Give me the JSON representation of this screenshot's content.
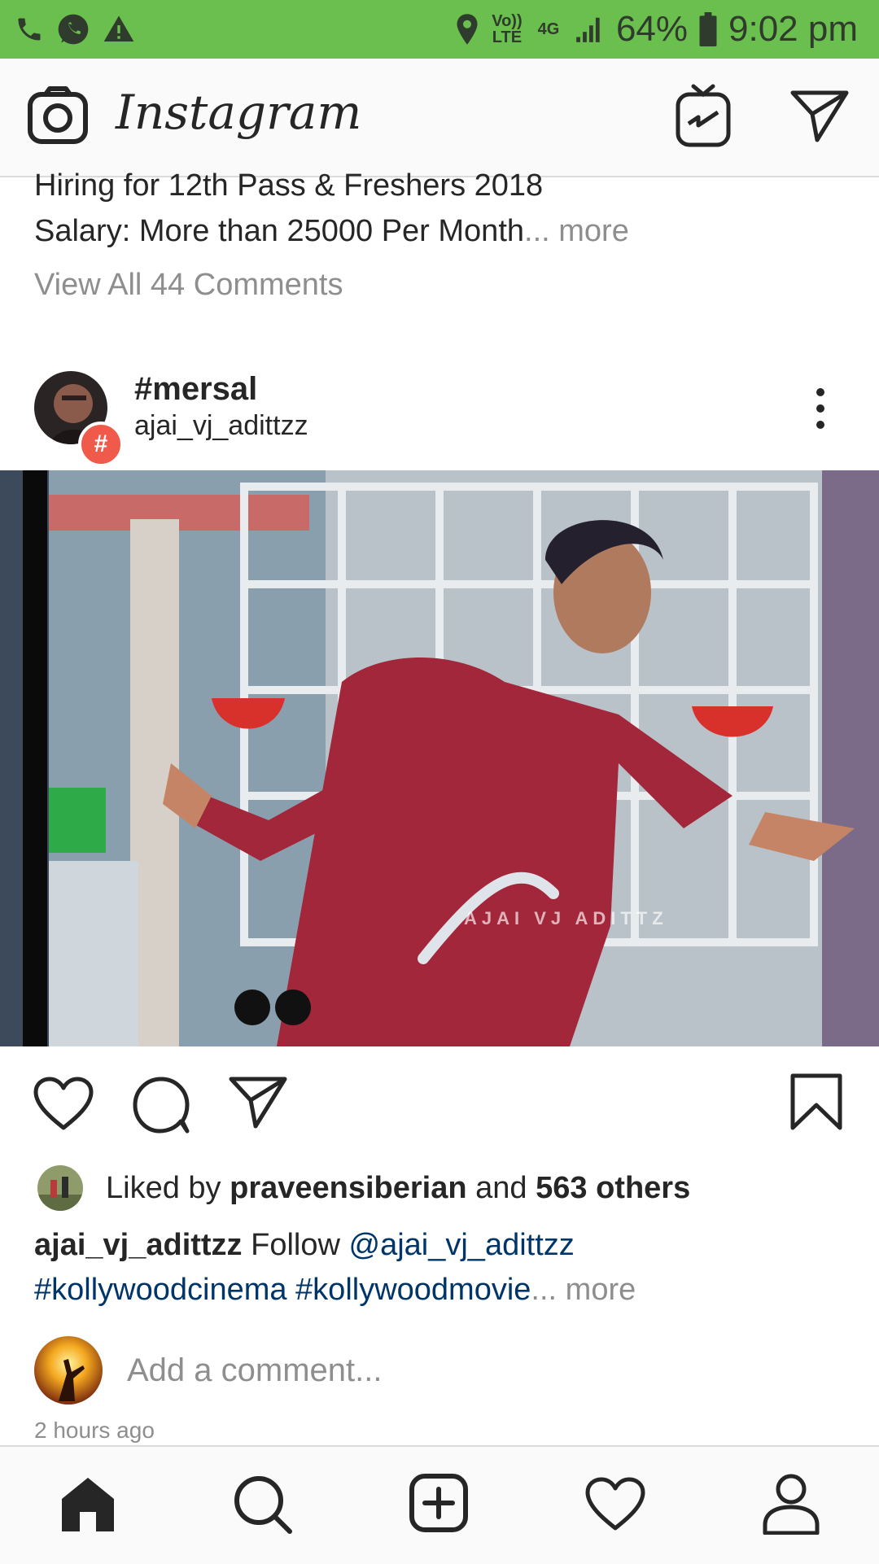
{
  "status_bar": {
    "volte": "Vo)) LTE",
    "network": "4G",
    "battery": "64%",
    "time": "9:02 pm",
    "icons": [
      "phone-icon",
      "whatsapp-icon",
      "warning-icon",
      "location-icon",
      "signal-icon",
      "battery-icon"
    ]
  },
  "header": {
    "app_name": "Instagram",
    "icons": [
      "camera-icon",
      "igtv-icon",
      "direct-message-icon"
    ]
  },
  "prev_post": {
    "caption_line1": "Hiring for 12th Pass & Freshers 2018",
    "caption_line2": "Salary: More than 25000 Per Month",
    "ellipsis": "...",
    "more": "more",
    "view_comments": "View All 44 Comments"
  },
  "post": {
    "title": "#mersal",
    "username": "ajai_vj_adittzz",
    "hashtag_badge": "#",
    "watermark": "AJAI VJ ADITTZ",
    "likes_prefix": "Liked by",
    "liked_by_user": "praveensiberian",
    "likes_and": "and",
    "likes_others": "563 others",
    "caption_user": "ajai_vj_adittzz",
    "caption_text": "Follow",
    "caption_mention": "@ajai_vj_adittzz",
    "caption_hashtags": "#kollywoodcinema #kollywoodmovie",
    "caption_ellipsis": "...",
    "caption_more": "more",
    "comment_placeholder": "Add a comment...",
    "time_ago": "2 hours ago"
  },
  "bottom_nav": [
    "home-icon",
    "search-icon",
    "add-post-icon",
    "activity-icon",
    "profile-icon"
  ],
  "colors": {
    "status_bar": "#6bbf4e",
    "text": "#262626",
    "secondary": "#8e8e8e",
    "link": "#003569"
  }
}
